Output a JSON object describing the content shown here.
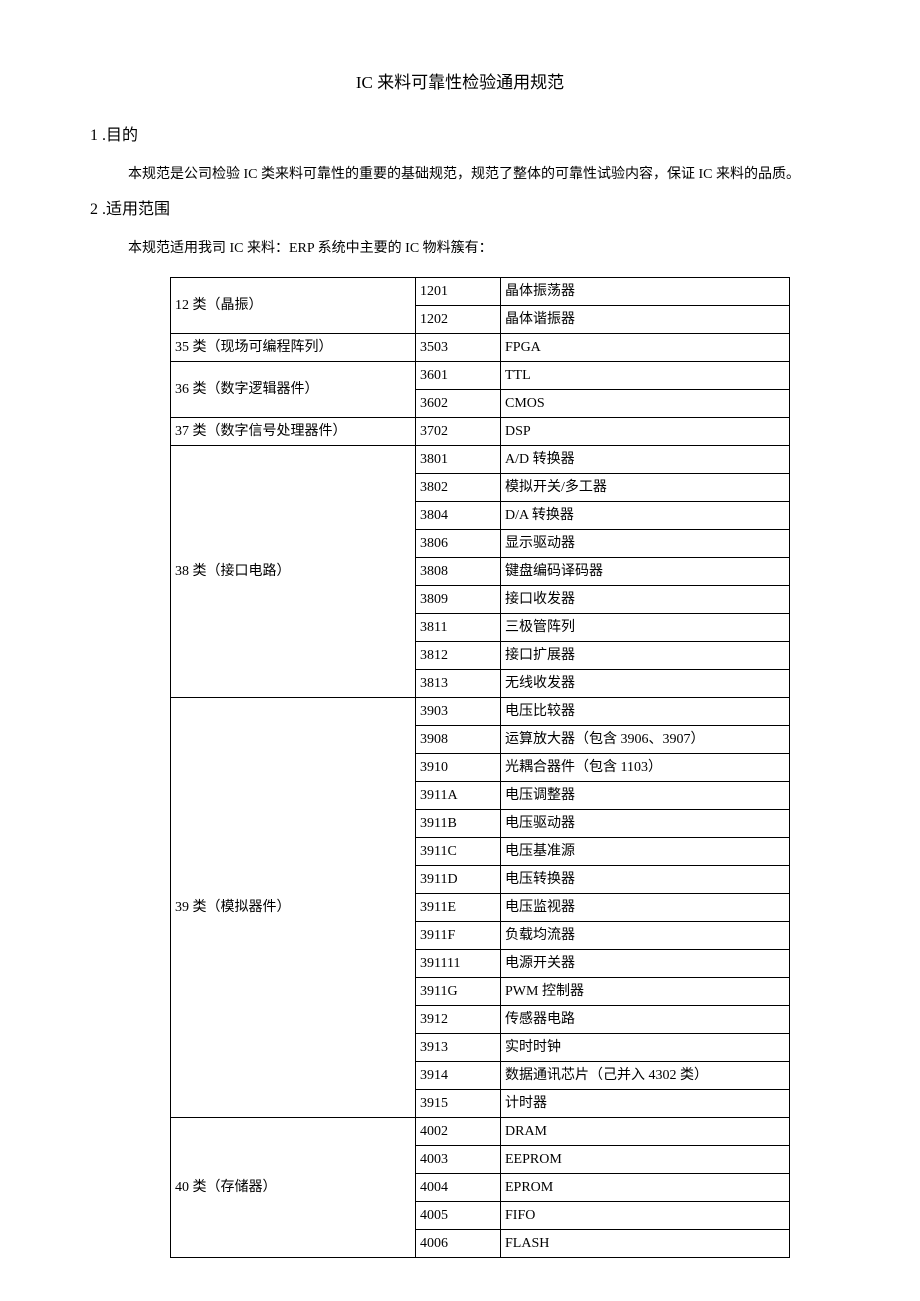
{
  "title": "IC 来料可靠性检验通用规范",
  "section1": {
    "num": "1",
    "label": ".目的",
    "body": "本规范是公司检验 IC 类来料可靠性的重要的基础规范，规范了整体的可靠性试验内容，保证 IC 来料的品质。"
  },
  "section2": {
    "num": "2",
    "label": ".适用范围",
    "body": "本规范适用我司 IC 来料：ERP 系统中主要的 IC 物料簇有：",
    "categories": [
      {
        "name": "12 类（晶振）",
        "codes": [
          {
            "code": "1201",
            "sub": "晶体振荡器"
          },
          {
            "code": "1202",
            "sub": "晶体谐振器"
          }
        ]
      },
      {
        "name": "35 类（现场可编程阵列）",
        "codes": [
          {
            "code": "3503",
            "sub": "FPGA"
          }
        ]
      },
      {
        "name": "36 类（数字逻辑器件）",
        "codes": [
          {
            "code": "3601",
            "sub": "TTL"
          },
          {
            "code": "3602",
            "sub": "CMOS"
          }
        ]
      },
      {
        "name": "37 类（数字信号处理器件）",
        "codes": [
          {
            "code": "3702",
            "sub": "DSP"
          }
        ]
      },
      {
        "name": "38 类（接口电路）",
        "codes": [
          {
            "code": "3801",
            "sub": "A/D 转换器"
          },
          {
            "code": "3802",
            "sub": "模拟开关/多工器"
          },
          {
            "code": "3804",
            "sub": "D/A 转换器"
          },
          {
            "code": "3806",
            "sub": "显示驱动器"
          },
          {
            "code": "3808",
            "sub": "键盘编码译码器"
          },
          {
            "code": "3809",
            "sub": "接口收发器"
          },
          {
            "code": "3811",
            "sub": "三极管阵列"
          },
          {
            "code": "3812",
            "sub": "接口扩展器"
          },
          {
            "code": "3813",
            "sub": "无线收发器"
          }
        ]
      },
      {
        "name": "39 类（模拟器件）",
        "codes": [
          {
            "code": "3903",
            "sub": "电压比较器"
          },
          {
            "code": "3908",
            "sub": "运算放大器（包含 3906、3907）"
          },
          {
            "code": "3910",
            "sub": "光耦合器件（包含 1103）"
          },
          {
            "code": "3911A",
            "sub": "电压调整器"
          },
          {
            "code": "3911B",
            "sub": "电压驱动器"
          },
          {
            "code": "3911C",
            "sub": "电压基准源"
          },
          {
            "code": "3911D",
            "sub": "电压转换器"
          },
          {
            "code": "3911E",
            "sub": "电压监视器"
          },
          {
            "code": "3911F",
            "sub": "负载均流器"
          },
          {
            "code": "391111",
            "sub": "电源开关器"
          },
          {
            "code": "3911G",
            "sub": "PWM 控制器"
          },
          {
            "code": "3912",
            "sub": "传感器电路"
          },
          {
            "code": "3913",
            "sub": "实时时钟"
          },
          {
            "code": "3914",
            "sub": "数据通讯芯片（己并入 4302 类）"
          },
          {
            "code": "3915",
            "sub": "计时器"
          }
        ]
      },
      {
        "name": "40 类（存储器）",
        "codes": [
          {
            "code": "4002",
            "sub": "DRAM"
          },
          {
            "code": "4003",
            "sub": "EEPROM"
          },
          {
            "code": "4004",
            "sub": "EPROM"
          },
          {
            "code": "4005",
            "sub": "FIFO"
          },
          {
            "code": "4006",
            "sub": "FLASH"
          }
        ]
      }
    ]
  }
}
